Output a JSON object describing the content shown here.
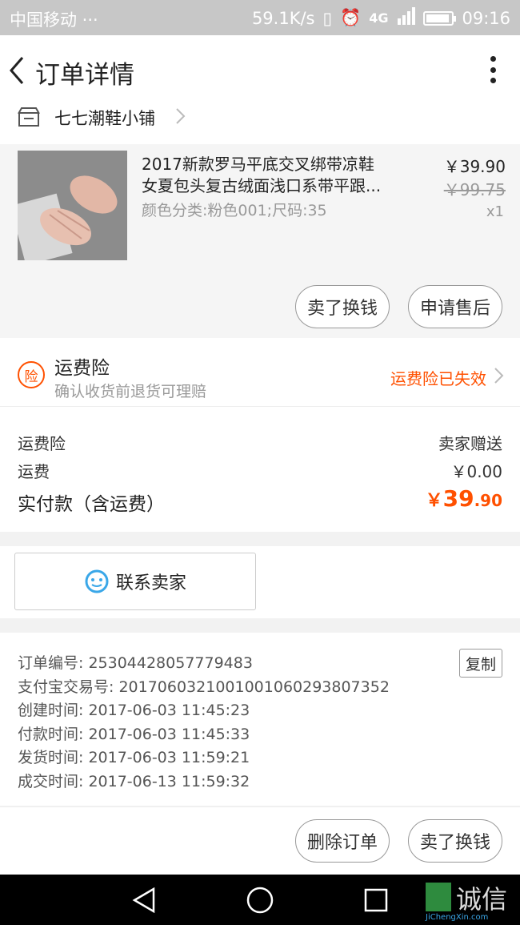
{
  "status_bar": {
    "carrier": "中国移动 ···",
    "speed": "59.1K/s",
    "network": "4G",
    "time": "09:16"
  },
  "header": {
    "title": "订单详情"
  },
  "shop": {
    "name": "七七潮鞋小铺"
  },
  "product": {
    "title_line1": "2017新款罗马平底交叉绑带凉鞋",
    "title_line2": "女夏包头复古绒面浅口系带平跟...",
    "sku": "颜色分类:粉色001;尺码:35",
    "price": "￥39.90",
    "original_price": "￥99.75",
    "quantity": "x1",
    "btn_sell": "卖了换钱",
    "btn_aftersale": "申请售后"
  },
  "insurance": {
    "badge": "险",
    "title": "运费险",
    "subtitle": "确认收货前退货可理赔",
    "status": "运费险已失效"
  },
  "fees": {
    "insurance_label": "运费险",
    "insurance_value": "卖家赠送",
    "shipping_label": "运费",
    "shipping_value": "￥0.00",
    "paid_label": "实付款（含运费）",
    "paid_currency": "￥",
    "paid_int": "39",
    "paid_dec": ".90"
  },
  "contact": {
    "label": "联系卖家"
  },
  "order_info": {
    "copy_label": "复制",
    "lines": [
      "订单编号: 253044280577794​83",
      "支付宝交易号: 2017060321001001060293807352",
      "创建时间: 2017-06-03 11:45:23",
      "付款时间: 2017-06-03 11:45:33",
      "发货时间: 2017-06-03 11:59:21",
      "成交时间: 2017-06-13 11:59:32"
    ]
  },
  "actions": {
    "delete": "删除订单",
    "sell": "卖了换钱"
  },
  "watermark": {
    "text": "诚信",
    "sub": "JiChengXin.com"
  },
  "colors": {
    "accent": "#ff5000",
    "chat": "#3aa7e8"
  }
}
